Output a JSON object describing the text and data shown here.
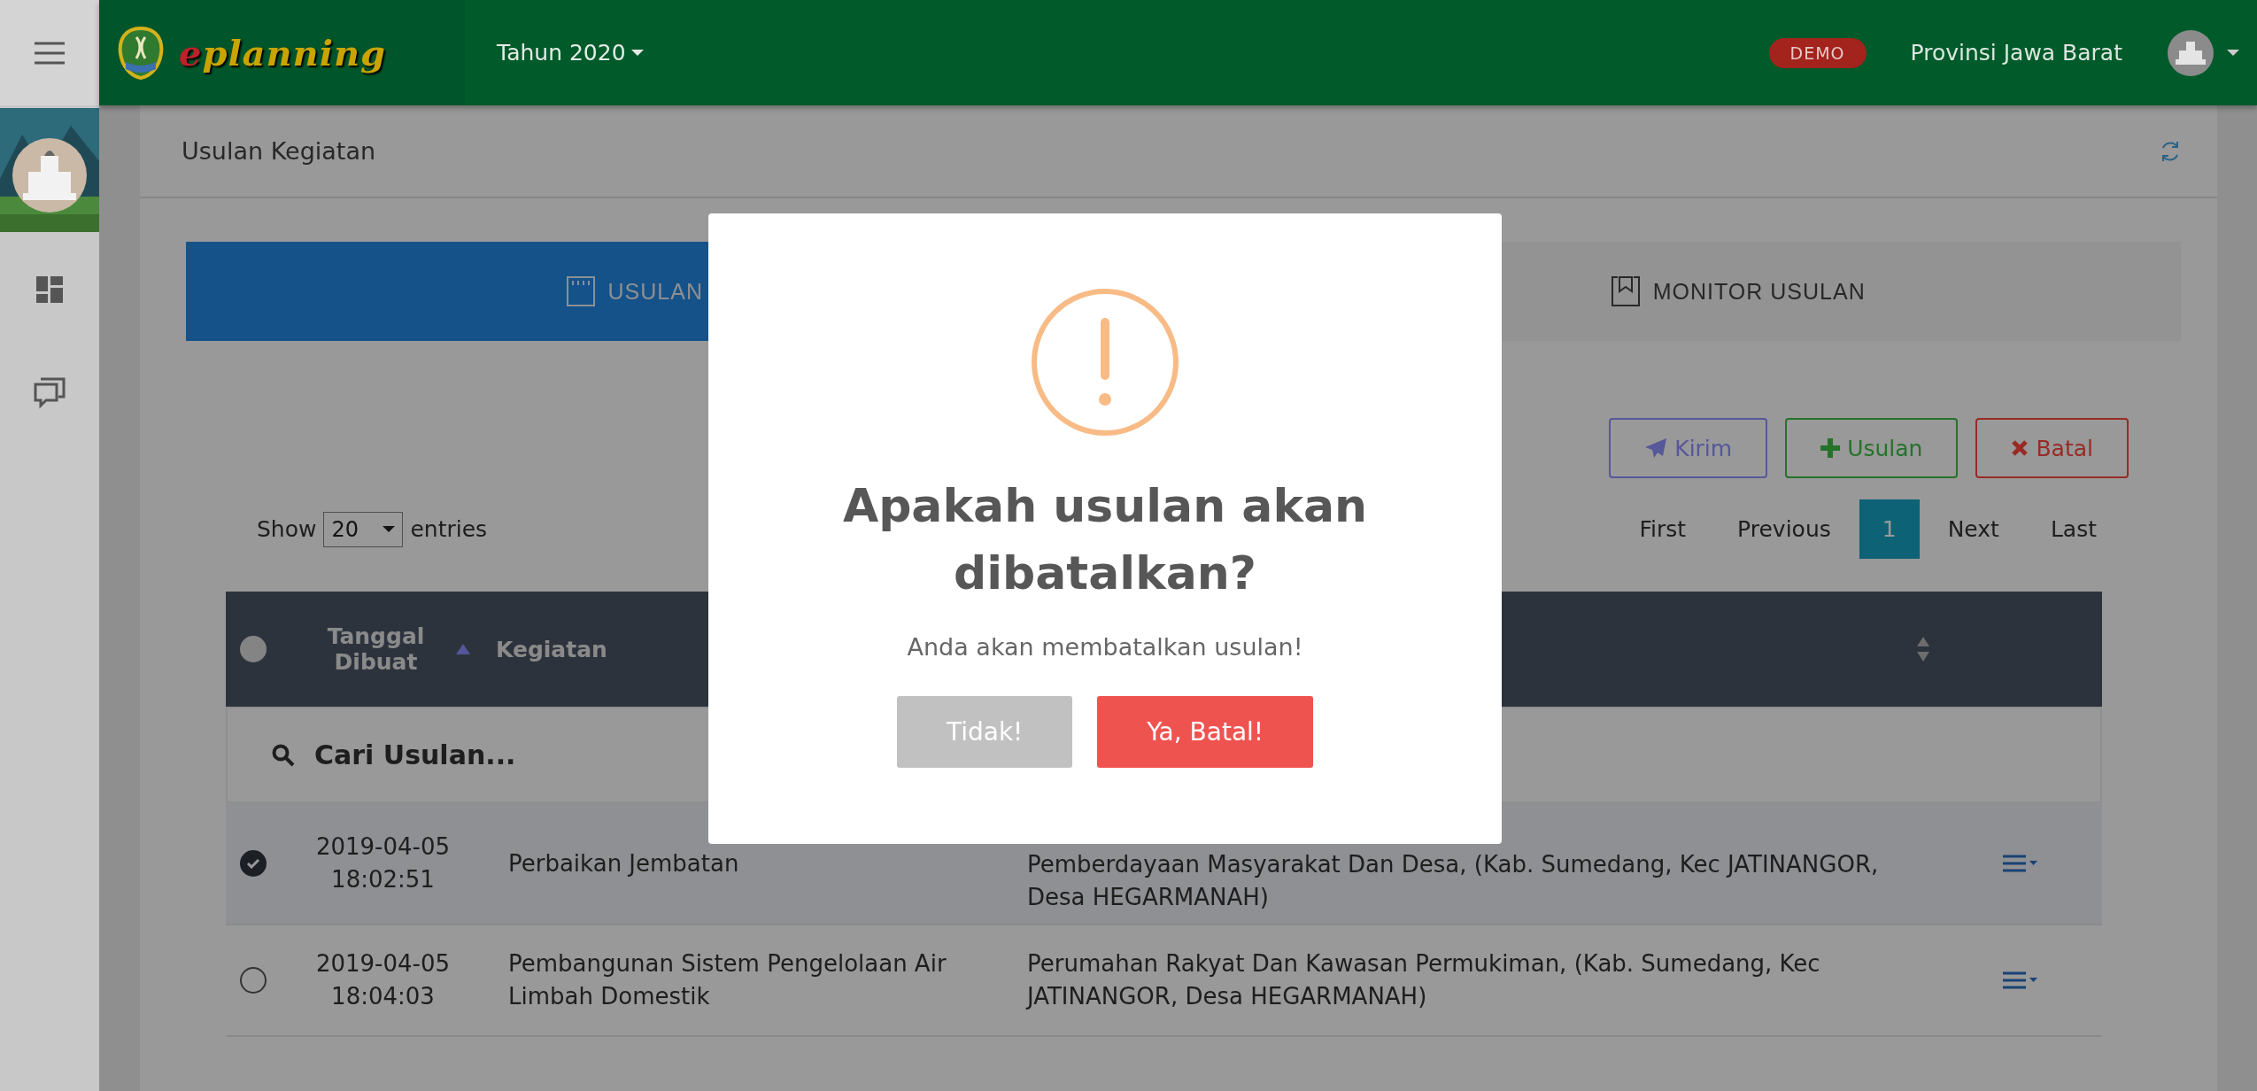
{
  "topbar": {
    "brand_prefix": "e",
    "brand_name": "planning",
    "year": "Tahun 2020",
    "badge": "DEMO",
    "user": "Provinsi Jawa Barat"
  },
  "page_title": "Usulan Kegiatan",
  "tabs": [
    {
      "label": "USULAN",
      "kind": "calendar",
      "selected": true
    },
    {
      "label": "MONITOR USULAN",
      "kind": "bookmark",
      "selected": false
    }
  ],
  "actions": [
    {
      "label": "Kirim",
      "kind": "send"
    },
    {
      "label": "Usulan",
      "kind": "add"
    },
    {
      "label": "Batal",
      "kind": "cancel"
    }
  ],
  "entries": {
    "before": "Show",
    "value": "20",
    "after": "entries"
  },
  "pagination": [
    {
      "label": "First",
      "selected": false
    },
    {
      "label": "Previous",
      "selected": false
    },
    {
      "label": "1",
      "selected": true
    },
    {
      "label": "Next",
      "selected": false
    },
    {
      "label": "Last",
      "selected": false
    }
  ],
  "table": {
    "header_checked": false,
    "columns": [
      {
        "label": "Tanggal Dibuat",
        "sorted": true
      },
      {
        "label": "Kegiatan",
        "sorted": false
      },
      {
        "sortable": true
      }
    ],
    "search": {
      "placeholder": "Cari Usulan..."
    },
    "rows": [
      {
        "checked": true,
        "date": "2019-04-05",
        "time": "18:02:51",
        "kegiatan": "Perbaikan Jembatan",
        "lokasi": "Pemberdayaan Masyarakat Dan Desa, (Kab. Sumedang, Kec JATINANGOR, Desa HEGARMANAH)"
      },
      {
        "checked": false,
        "date": "2019-04-05",
        "time": "18:04:03",
        "kegiatan": "Pembangunan Sistem Pengelolaan Air Limbah Domestik",
        "lokasi": "Perumahan Rakyat Dan Kawasan Permukiman, (Kab. Sumedang, Kec JATINANGOR, Desa HEGARMANAH)"
      }
    ]
  },
  "modal": {
    "title": "Apakah usulan akan dibatalkan?",
    "text": "Anda akan membatalkan usulan!",
    "buttons": [
      {
        "label": "Tidak!",
        "kind": "cancel"
      },
      {
        "label": "Ya, Batal!",
        "kind": "confirm"
      }
    ]
  }
}
